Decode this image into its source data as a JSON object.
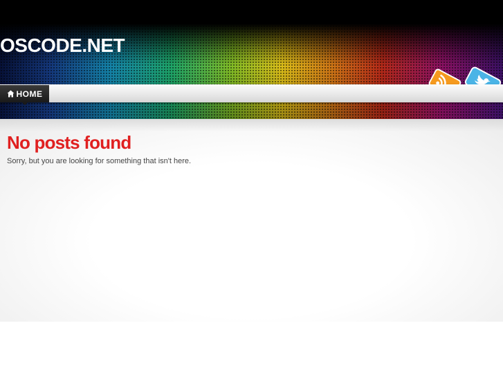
{
  "site": {
    "title": "OSCODE.NET"
  },
  "nav": {
    "items": [
      {
        "label": "HOME",
        "icon": "home-icon",
        "active": true
      }
    ]
  },
  "social": {
    "icons": [
      "rss-icon",
      "twitter-icon"
    ]
  },
  "main": {
    "heading": "No posts found",
    "message": "Sorry, but you are looking for something that isn't here."
  },
  "colors": {
    "heading": "#e02020",
    "nav_active_bg": "#1a1a1a",
    "rss": "#f59a1e",
    "twitter": "#4ab4e6"
  }
}
